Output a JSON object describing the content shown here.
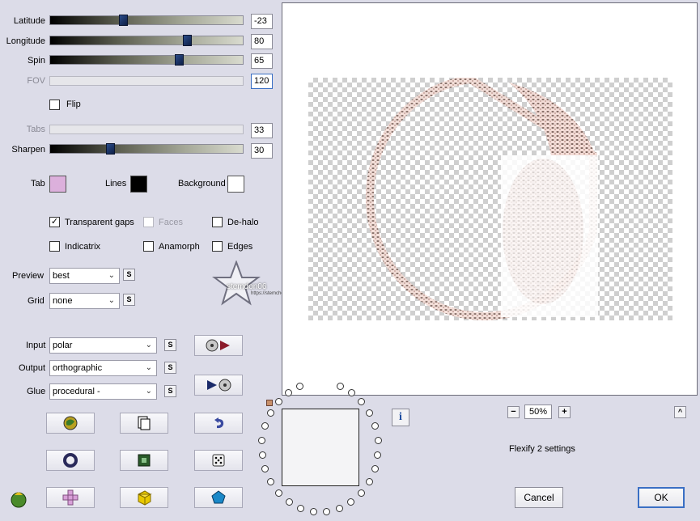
{
  "sliders": [
    {
      "label": "Latitude",
      "value": "-23",
      "fraction": 0.38,
      "disabled": false
    },
    {
      "label": "Longitude",
      "value": "80",
      "fraction": 0.71,
      "disabled": false
    },
    {
      "label": "Spin",
      "value": "65",
      "fraction": 0.67,
      "disabled": false
    },
    {
      "label": "FOV",
      "value": "120",
      "fraction": null,
      "disabled": true
    }
  ],
  "flip": {
    "label": "Flip",
    "checked": false
  },
  "tabs_slider": {
    "label": "Tabs",
    "value": "33",
    "disabled": true
  },
  "sharpen": {
    "label": "Sharpen",
    "value": "30",
    "fraction": 0.31
  },
  "colors": {
    "tab": {
      "label": "Tab",
      "color": "#dcb0dc"
    },
    "lines": {
      "label": "Lines",
      "color": "#000000"
    },
    "background": {
      "label": "Background",
      "color": "#ffffff"
    }
  },
  "checkboxes": {
    "transparent_gaps": {
      "label": "Transparent gaps",
      "checked": true
    },
    "faces": {
      "label": "Faces",
      "checked": false,
      "disabled": true
    },
    "dehalo": {
      "label": "De-halo",
      "checked": false
    },
    "indicatrix": {
      "label": "Indicatrix",
      "checked": false
    },
    "anamorph": {
      "label": "Anamorph",
      "checked": false
    },
    "edges": {
      "label": "Edges",
      "checked": false
    }
  },
  "preview": {
    "label": "Preview",
    "value": "best"
  },
  "grid": {
    "label": "Grid",
    "value": "none"
  },
  "input": {
    "label": "Input",
    "value": "polar"
  },
  "output": {
    "label": "Output",
    "value": "orthographic"
  },
  "glue": {
    "label": "Glue",
    "value": "procedural -"
  },
  "s_label": "S",
  "watermark": {
    "name": "stemdon06",
    "url": "https://stemchenelentadesignchen.net"
  },
  "zoom": {
    "minus": "−",
    "value": "50%",
    "plus": "+"
  },
  "collapse": "^",
  "status": "Flexify 2 settings",
  "buttons": {
    "cancel": "Cancel",
    "ok": "OK"
  },
  "info": "i"
}
